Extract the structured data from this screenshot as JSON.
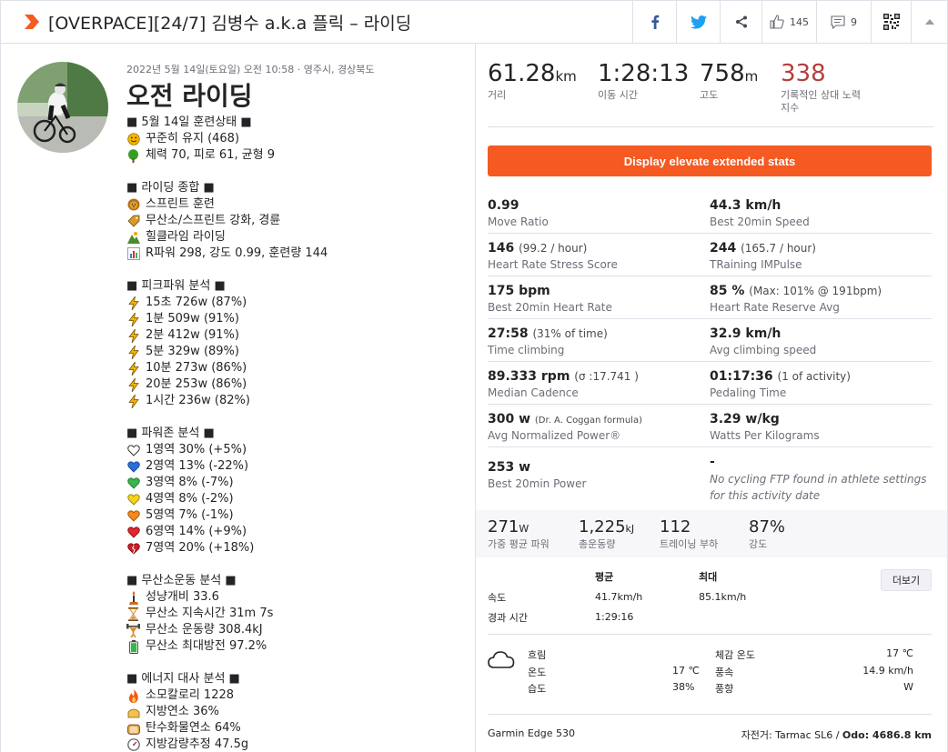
{
  "header": {
    "title": "[OVERPACE][24/7] 김병수 a.k.a 플릭 – 라이딩",
    "kudos_count": "145",
    "comments_count": "9"
  },
  "activity": {
    "meta": "2022년 5월 14일(토요일) 오전 10:58 · 영주시, 경상북도",
    "name": "오전 라이딩"
  },
  "description": [
    {
      "icon": "black-square",
      "text": "■ 5월 14일 훈련상태 ■"
    },
    {
      "icon": "smile-icon",
      "text": "꾸준히 유지 (468)"
    },
    {
      "icon": "tree-icon",
      "text": "체력 70, 피로 61, 균형 9"
    },
    {
      "icon": "",
      "text": ""
    },
    {
      "icon": "black-square",
      "text": "■ 라이딩 종합 ■"
    },
    {
      "icon": "lion-icon",
      "text": "스프린트 훈련"
    },
    {
      "icon": "tag-icon",
      "text": "무산소/스프린트 강화, 경륜"
    },
    {
      "icon": "climb-icon",
      "text": "힐클라임 라이딩"
    },
    {
      "icon": "chart-icon",
      "text": "R파워 298, 강도 0.99, 훈련량 144"
    },
    {
      "icon": "",
      "text": ""
    },
    {
      "icon": "black-square",
      "text": "■ 피크파워 분석 ■"
    },
    {
      "icon": "bolt-icon",
      "text": "15초 726w (87%)"
    },
    {
      "icon": "bolt-icon",
      "text": "1분 509w (91%)"
    },
    {
      "icon": "bolt-icon",
      "text": "2분 412w (91%)"
    },
    {
      "icon": "bolt-icon",
      "text": "5분 329w (89%)"
    },
    {
      "icon": "bolt-icon",
      "text": "10분 273w (86%)"
    },
    {
      "icon": "bolt-icon",
      "text": "20분 253w (86%)"
    },
    {
      "icon": "bolt-icon",
      "text": "1시간 236w (82%)"
    },
    {
      "icon": "",
      "text": ""
    },
    {
      "icon": "black-square",
      "text": "■ 파워존 분석 ■"
    },
    {
      "icon": "white-heart-icon",
      "text": "1영역 30% (+5%)"
    },
    {
      "icon": "blue-heart-icon",
      "text": "2영역 13% (-22%)"
    },
    {
      "icon": "green-heart-icon",
      "text": "3영역 8% (-7%)"
    },
    {
      "icon": "yellow-heart-icon",
      "text": "4영역 8% (-2%)"
    },
    {
      "icon": "orange-heart-icon",
      "text": "5영역 7% (-1%)"
    },
    {
      "icon": "red-heart-icon",
      "text": "6영역 14% (+9%)"
    },
    {
      "icon": "broken-heart-icon",
      "text": "7영역 20% (+18%)"
    },
    {
      "icon": "",
      "text": ""
    },
    {
      "icon": "black-square",
      "text": "■ 무산소운동 분석 ■"
    },
    {
      "icon": "candle-icon",
      "text": "성냥개비 33.6"
    },
    {
      "icon": "hourglass-icon",
      "text": "무산소 지속시간 31m 7s"
    },
    {
      "icon": "weightlift-icon",
      "text": "무산소 운동량 308.4kJ"
    },
    {
      "icon": "battery-icon",
      "text": "무산소 최대방전 97.2%"
    },
    {
      "icon": "",
      "text": ""
    },
    {
      "icon": "black-square",
      "text": "■ 에너지 대사 분석 ■"
    },
    {
      "icon": "fire-icon",
      "text": "소모칼로리 1228"
    },
    {
      "icon": "fat-icon",
      "text": "지방연소 36%"
    },
    {
      "icon": "bread-icon",
      "text": "탄수화물연소 64%"
    },
    {
      "icon": "gauge-icon",
      "text": "지방감량추정 47.5g"
    }
  ],
  "icon_colors": {
    "smile-icon": "#f5b400",
    "tree-icon": "#3a9d23",
    "lion-icon": "#e0a030",
    "tag-icon": "#d99a2b",
    "climb-icon": "#4c8b2b",
    "chart-icon": "#3a7bd5",
    "bolt-icon": "#f0b400",
    "white-heart-icon": "#ffffff",
    "blue-heart-icon": "#2b6fd6",
    "green-heart-icon": "#39b54a",
    "yellow-heart-icon": "#f7d21b",
    "orange-heart-icon": "#f7881b",
    "red-heart-icon": "#e0262f",
    "broken-heart-icon": "#d0202a",
    "candle-icon": "#c86a2a",
    "hourglass-icon": "#c8863a",
    "weightlift-icon": "#d98b2b",
    "battery-icon": "#39b54a",
    "fire-icon": "#f05a1a",
    "fat-icon": "#f2c14e",
    "bread-icon": "#e0a040",
    "gauge-icon": "#555555",
    "black-square": "#242428"
  },
  "big_stats": [
    {
      "value": "61.28",
      "unit": "km",
      "label": "거리"
    },
    {
      "value": "1:28:13",
      "unit": "",
      "label": "이동 시간"
    },
    {
      "value": "758",
      "unit": "m",
      "label": "고도"
    },
    {
      "value": "338",
      "unit": "",
      "label": "기록적인 상대 노력 지수"
    }
  ],
  "elevate_label": "Display elevate extended stats",
  "extended": {
    "move_ratio": {
      "value": "0.99",
      "label": "Move Ratio"
    },
    "best20_speed": {
      "value": "44.3 km/h",
      "label": "Best 20min Speed"
    },
    "hrss": {
      "value": "146",
      "sub": "(99.2 / hour)",
      "label": "Heart Rate Stress Score"
    },
    "trimp": {
      "value": "244",
      "sub": "(165.7 / hour)",
      "label": "TRaining IMPulse"
    },
    "best20_hr": {
      "value": "175 bpm",
      "label": "Best 20min Heart Rate"
    },
    "hrr": {
      "value": "85 %",
      "sub": "(Max: 101% @ 191bpm)",
      "label": "Heart Rate Reserve Avg"
    },
    "time_climbing": {
      "value": "27:58",
      "sub": "(31% of time)",
      "label": "Time climbing"
    },
    "avg_climb_speed": {
      "value": "32.9 km/h",
      "label": "Avg climbing speed"
    },
    "cadence": {
      "value": "89.333 rpm",
      "sub": "(σ :17.741 )",
      "label": "Median Cadence"
    },
    "pedaling": {
      "value": "01:17:36",
      "sub": "(1 of activity)",
      "label": "Pedaling Time"
    },
    "np": {
      "value": "300 w",
      "sub": "(Dr. A. Coggan formula)",
      "label": "Avg Normalized Power®"
    },
    "wkg": {
      "value": "3.29 w/kg",
      "label": "Watts Per Kilograms"
    },
    "best20_power": {
      "value": "253 w",
      "label": "Best 20min Power"
    },
    "ftp": {
      "value": "-",
      "note": "No cycling FTP found in athlete settings for this activity date"
    }
  },
  "summary": [
    {
      "value": "271",
      "unit": "W",
      "label": "가중 평균 파워"
    },
    {
      "value": "1,225",
      "unit": "kJ",
      "label": "총운동량"
    },
    {
      "value": "112",
      "unit": "",
      "label": "트레이닝 부하"
    },
    {
      "value": "87%",
      "unit": "",
      "label": "강도"
    }
  ],
  "avg_table": {
    "h_avg": "평균",
    "h_max": "최대",
    "r1": "속도",
    "r1_avg": "41.7km/h",
    "r1_max": "85.1km/h",
    "r2": "경과 시간",
    "r2_avg": "1:29:16",
    "more": "더보기"
  },
  "weather": {
    "cond": "흐림",
    "temp_label": "온도",
    "temp": "17 ℃",
    "hum_label": "습도",
    "hum": "38%",
    "feel_label": "체감 온도",
    "feel": "17 ℃",
    "wind_label": "풍속",
    "wind": "14.9 km/h",
    "dir_label": "풍향",
    "dir": "W"
  },
  "footer": {
    "device": "Garmin Edge 530",
    "bike_prefix": "자전거: Tarmac SL6 / ",
    "odo": "Odo: 4686.8 km"
  },
  "colors": {
    "accent": "#f45a22",
    "effort_red": "#b43f3d"
  }
}
